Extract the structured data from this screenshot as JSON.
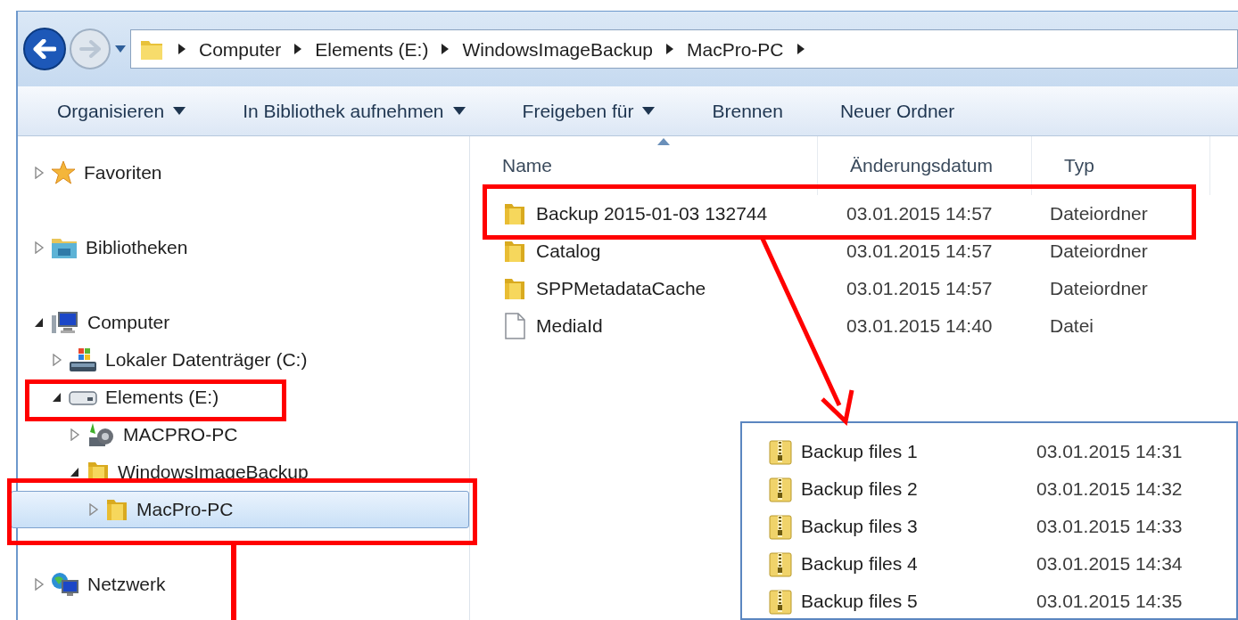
{
  "breadcrumb": [
    "Computer",
    "Elements (E:)",
    "WindowsImageBackup",
    "MacPro-PC"
  ],
  "toolbar": [
    {
      "label": "Organisieren",
      "dropdown": true
    },
    {
      "label": "In Bibliothek aufnehmen",
      "dropdown": true
    },
    {
      "label": "Freigeben für",
      "dropdown": true
    },
    {
      "label": "Brennen",
      "dropdown": false
    },
    {
      "label": "Neuer Ordner",
      "dropdown": false
    }
  ],
  "navigation_tree": [
    {
      "label": "Favoriten",
      "kind": "star",
      "expanded": false,
      "selected": false
    },
    {
      "label": "Bibliotheken",
      "kind": "library",
      "expanded": false,
      "selected": false
    },
    {
      "label": "Computer",
      "kind": "computer",
      "expanded": true,
      "selected": false,
      "children": [
        {
          "label": "Lokaler Datenträger (C:)",
          "kind": "systemdrive",
          "expanded": false,
          "selected": false
        },
        {
          "label": "Elements (E:)",
          "kind": "drive",
          "expanded": true,
          "selected": false,
          "children": [
            {
              "label": "MACPRO-PC",
              "kind": "backup",
              "expanded": false,
              "selected": false
            },
            {
              "label": "WindowsImageBackup",
              "kind": "folder",
              "expanded": true,
              "selected": false,
              "children": [
                {
                  "label": "MacPro-PC",
                  "kind": "folder",
                  "expanded": false,
                  "selected": true
                }
              ]
            }
          ]
        }
      ]
    },
    {
      "label": "Netzwerk",
      "kind": "network",
      "expanded": false,
      "selected": false
    }
  ],
  "file_list": {
    "columns": [
      "Name",
      "Änderungsdatum",
      "Typ"
    ],
    "rows": [
      {
        "name": "Backup 2015-01-03 132744",
        "date": "03.01.2015 14:57",
        "type": "Dateiordner",
        "kind": "folder"
      },
      {
        "name": "Catalog",
        "date": "03.01.2015 14:57",
        "type": "Dateiordner",
        "kind": "folder"
      },
      {
        "name": "SPPMetadataCache",
        "date": "03.01.2015 14:57",
        "type": "Dateiordner",
        "kind": "folder"
      },
      {
        "name": "MediaId",
        "date": "03.01.2015 14:40",
        "type": "Datei",
        "kind": "file"
      }
    ]
  },
  "inset_list": {
    "rows": [
      {
        "name": "Backup files 1",
        "date": "03.01.2015 14:31"
      },
      {
        "name": "Backup files 2",
        "date": "03.01.2015 14:32"
      },
      {
        "name": "Backup files 3",
        "date": "03.01.2015 14:33"
      },
      {
        "name": "Backup files 4",
        "date": "03.01.2015 14:34"
      },
      {
        "name": "Backup files 5",
        "date": "03.01.2015 14:35"
      }
    ]
  }
}
